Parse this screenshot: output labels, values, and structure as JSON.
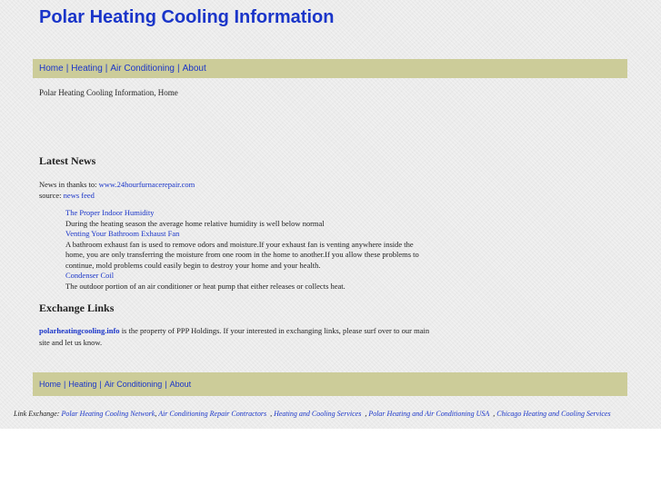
{
  "site": {
    "title": "Polar Heating Cooling Information"
  },
  "top_nav": [
    {
      "label": "Home"
    },
    {
      "label": "Heating"
    },
    {
      "label": "Air Conditioning"
    },
    {
      "label": "About"
    }
  ],
  "nav_separator": "|",
  "breadcrumb": "Polar Heating Cooling Information, Home",
  "latest_news": {
    "heading": "Latest News",
    "credit_prefix": "News in thanks to:",
    "credit_link": "www.24hourfurnacerepair.com",
    "source_prefix": "source:",
    "source_link": "news feed",
    "items": [
      {
        "title": "The Proper Indoor Humidity",
        "desc": "During the heating season the average home relative humidity is well below normal"
      },
      {
        "title": "Venting Your Bathroom Exhaust Fan",
        "desc": "A bathroom exhaust fan is used to remove odors and moisture.If your exhaust fan is venting anywhere inside the home, you are only transferring the moisture from one room in the home to another.If you allow these problems to continue, mold problems could easily begin to destroy your home and your health."
      },
      {
        "title": "Condenser Coil",
        "desc": "The outdoor portion of an air conditioner or heat pump that either releases or collects heat."
      }
    ]
  },
  "exchange": {
    "heading": "Exchange Links",
    "domain_link": "polarheatingcooling.info",
    "text": " is the property of PPP Holdings. If your interested in exchanging links, please surf over to our main site and let us know."
  },
  "bottom_nav": [
    {
      "label": "Home"
    },
    {
      "label": "Heating"
    },
    {
      "label": "Air Conditioning"
    },
    {
      "label": "About"
    }
  ],
  "link_exchange": {
    "label": "Link Exchange:",
    "links": [
      {
        "label": "Polar Heating Cooling Network"
      },
      {
        "label": "Air Conditioning Repair Contractors"
      },
      {
        "label": "Heating and Cooling Services"
      },
      {
        "label": "Polar Heating and Air Conditioning USA"
      },
      {
        "label": "Chicago Heating and Cooling Services"
      }
    ]
  },
  "colors": {
    "link": "#1a35c9",
    "nav_bar": "#cccc99",
    "page_bg": "#ebebeb"
  }
}
